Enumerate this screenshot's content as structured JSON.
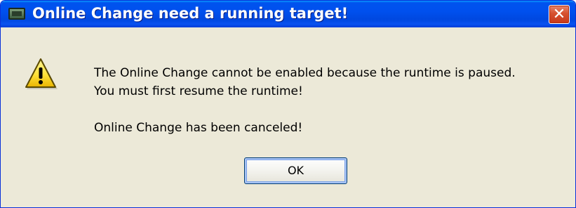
{
  "window": {
    "title": "Online Change need a running target!",
    "close_label": "✕"
  },
  "dialog": {
    "icon": "warning-icon",
    "message_line1": "The Online Change cannot be enabled because the runtime is paused.",
    "message_line2": "You must first resume the runtime!",
    "message_line3": "Online Change has been canceled!",
    "ok_label": "OK"
  },
  "colors": {
    "titlebar": "#0053ee",
    "face": "#ece9d8",
    "close": "#d6502f",
    "warning": "#ffe23a"
  }
}
